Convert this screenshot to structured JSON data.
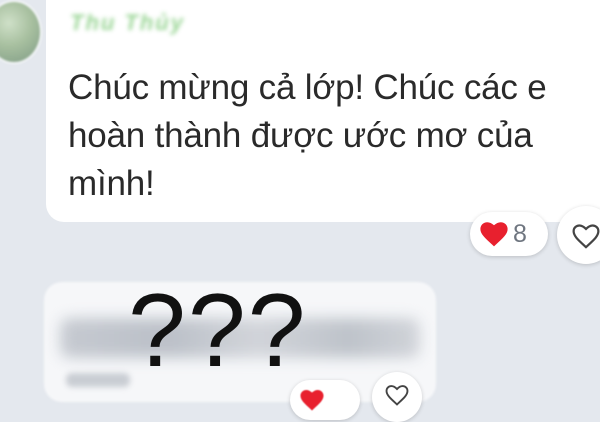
{
  "message": {
    "sender_name": "Thu Thủy",
    "text": "Chúc mừng cả lớp! Chúc các e hoàn thành được ước mơ của mình!",
    "reaction_count": "8",
    "reaction_icon": "red-heart-icon",
    "like_icon": "heart-outline-icon"
  },
  "reply": {
    "overlay_text": "???",
    "reaction_icon": "red-heart-icon",
    "like_icon": "heart-outline-icon"
  },
  "colors": {
    "background": "#e4e8ee",
    "bubble": "#ffffff",
    "heart_red": "#e8202e",
    "sender_name_green": "#8fd18a"
  }
}
